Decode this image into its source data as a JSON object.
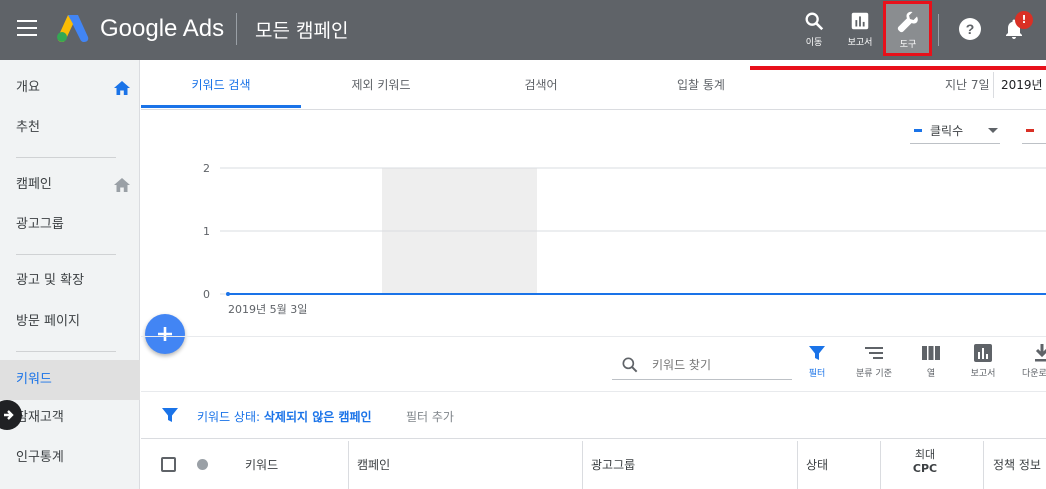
{
  "header": {
    "brand": "Google Ads",
    "page_title": "모든 캠페인",
    "actions": [
      {
        "label": "이동",
        "icon": "search-icon"
      },
      {
        "label": "보고서",
        "icon": "bar-chart-icon"
      },
      {
        "label": "도구",
        "icon": "wrench-icon"
      }
    ],
    "notification_badge": "!"
  },
  "sidebar": {
    "items": [
      {
        "label": "개요",
        "icon": "home-icon"
      },
      {
        "label": "추천"
      },
      {
        "label": "캠페인",
        "icon": "home-icon"
      },
      {
        "label": "광고그룹"
      },
      {
        "label": "광고 및 확장"
      },
      {
        "label": "방문 페이지"
      },
      {
        "label": "키워드",
        "active": true
      },
      {
        "label": "잠재고객"
      },
      {
        "label": "인구통계"
      }
    ]
  },
  "tabs": [
    "키워드 검색",
    "제외 키워드",
    "검색어",
    "입찰 통계"
  ],
  "date": {
    "range_label": "지난 7일",
    "value": "2019년"
  },
  "chart": {
    "metric_1": "클릭수",
    "y_ticks": [
      "2",
      "1",
      "0"
    ],
    "x_label": "2019년 5월 3일"
  },
  "chart_data": {
    "type": "line",
    "x": [
      "2019년 5월 3일"
    ],
    "series": [
      {
        "name": "클릭수",
        "values": [
          0
        ]
      }
    ],
    "ylim": [
      0,
      2
    ],
    "y_ticks": [
      0,
      1,
      2
    ],
    "grid": true,
    "colors": [
      "#1a73e8",
      "#d93025"
    ]
  },
  "toolbar": {
    "search_placeholder": "키워드 찾기",
    "actions": [
      {
        "label": "필터",
        "icon": "filter-icon"
      },
      {
        "label": "분류 기준",
        "icon": "segment-icon"
      },
      {
        "label": "열",
        "icon": "columns-icon"
      },
      {
        "label": "보고서",
        "icon": "report-icon"
      },
      {
        "label": "다운로",
        "icon": "download-icon"
      }
    ]
  },
  "filter": {
    "prefix": "키워드 상태: ",
    "value": "삭제되지 않은 캠페인",
    "add_label": "필터 추가"
  },
  "table": {
    "headers": [
      "키워드",
      "캠페인",
      "광고그룹",
      "상태",
      "최대",
      "CPC",
      "정책 정보"
    ]
  },
  "colors": {
    "topbar": "#5f6368",
    "accent": "#1a73e8",
    "highlight": "#e8101a"
  }
}
